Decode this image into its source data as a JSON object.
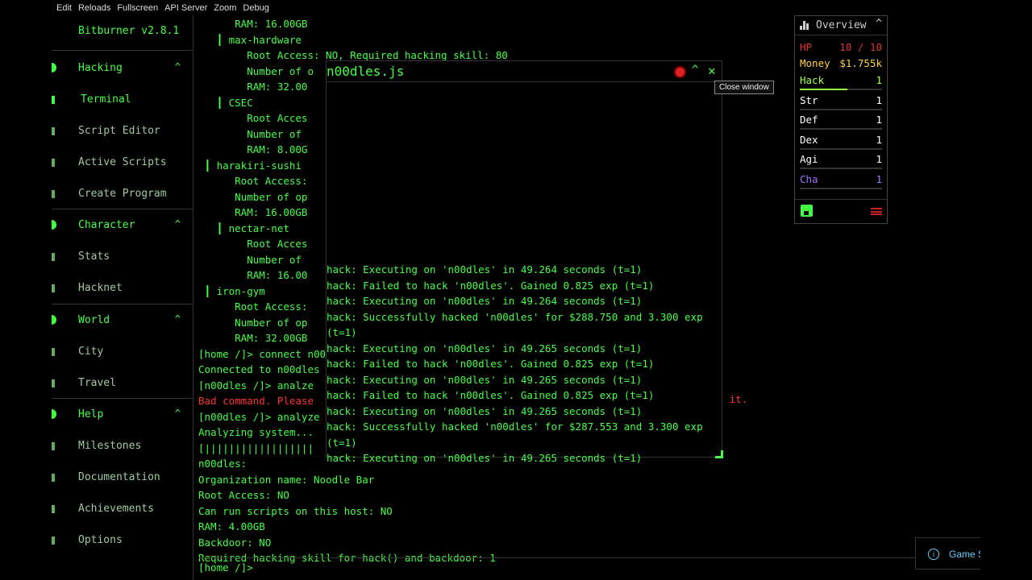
{
  "menubar": [
    "Edit",
    "Reloads",
    "Fullscreen",
    "API Server",
    "Zoom",
    "Debug"
  ],
  "sidebar": {
    "title": "Bitburner v2.8.1",
    "sections": [
      {
        "label": "Hacking",
        "chevron": "^",
        "items": [
          "Terminal",
          "Script Editor",
          "Active Scripts",
          "Create Program"
        ]
      },
      {
        "label": "Character",
        "chevron": "^",
        "items": [
          "Stats",
          "Hacknet"
        ]
      },
      {
        "label": "World",
        "chevron": "^",
        "items": [
          "City",
          "Travel"
        ]
      },
      {
        "label": "Help",
        "chevron": "^",
        "items": [
          "Milestones",
          "Documentation",
          "Achievements",
          "Options"
        ]
      }
    ],
    "active_item": "Terminal"
  },
  "terminal": {
    "lines": [
      "      RAM: 16.00GB",
      "   ┃ max-hardware",
      "        Root Access: NO, Required hacking skill: 80",
      "        Number of o",
      "        RAM: 32.00",
      "   ┃ CSEC",
      "        Root Acces",
      "        Number of ",
      "        RAM: 8.00G",
      " ┃ harakiri-sushi",
      "      Root Access:",
      "      Number of op",
      "      RAM: 16.00GB",
      "   ┃ nectar-net",
      "        Root Acces",
      "        Number of ",
      "        RAM: 16.00",
      " ┃ iron-gym",
      "      Root Access:",
      "      Number of op",
      "      RAM: 32.00GB",
      "[home /]> connect n00",
      "Connected to n00dles",
      "[n00dles /]> analze",
      "Bad command. Please",
      "[n00dles /]> analyze",
      "Analyzing system...",
      "[||||||||||||||||||",
      "n00dles:",
      "Organization name: Noodle Bar",
      "Root Access: NO",
      "Can run scripts on this host: NO",
      "RAM: 4.00GB",
      "Backdoor: NO",
      "Required hacking skill for hack() and backdoor: 1"
    ],
    "error_tail": "ip it.",
    "prompt": "[home /]>"
  },
  "log_window": {
    "title": "n00dles.js",
    "tooltip": "Close window",
    "lines": [
      "hack: Executing on 'n00dles' in 49.264 seconds (t=1)",
      "hack: Failed to hack 'n00dles'. Gained 0.825 exp (t=1)",
      "hack: Executing on 'n00dles' in 49.264 seconds (t=1)",
      "hack: Successfully hacked 'n00dles' for $288.750 and 3.300 exp",
      "(t=1)",
      "hack: Executing on 'n00dles' in 49.265 seconds (t=1)",
      "hack: Failed to hack 'n00dles'. Gained 0.825 exp (t=1)",
      "hack: Executing on 'n00dles' in 49.265 seconds (t=1)",
      "hack: Failed to hack 'n00dles'. Gained 0.825 exp (t=1)",
      "hack: Executing on 'n00dles' in 49.265 seconds (t=1)",
      "hack: Successfully hacked 'n00dles' for $287.553 and 3.300 exp",
      "(t=1)",
      "hack: Executing on 'n00dles' in 49.265 seconds (t=1)"
    ]
  },
  "overview": {
    "title": "Overview",
    "hp_label": "HP",
    "hp_value": "10 / 10",
    "money_label": "Money",
    "money_value": "$1.755k",
    "stats": [
      {
        "label": "Hack",
        "value": "1",
        "progress": 0.58,
        "color": "#a0ff50"
      },
      {
        "label": "Str",
        "value": "1",
        "progress": 0,
        "color": "#ffffff"
      },
      {
        "label": "Def",
        "value": "1",
        "progress": 0,
        "color": "#ffffff"
      },
      {
        "label": "Dex",
        "value": "1",
        "progress": 0,
        "color": "#ffffff"
      },
      {
        "label": "Agi",
        "value": "1",
        "progress": 0,
        "color": "#ffffff"
      },
      {
        "label": "Cha",
        "value": "1",
        "progress": 0,
        "color": "#a070ff"
      }
    ],
    "colors": {
      "hp": "#dd3333",
      "money": "#ffd040",
      "accent": "#44ff44"
    }
  },
  "toast": {
    "text": "Game Saved!"
  }
}
